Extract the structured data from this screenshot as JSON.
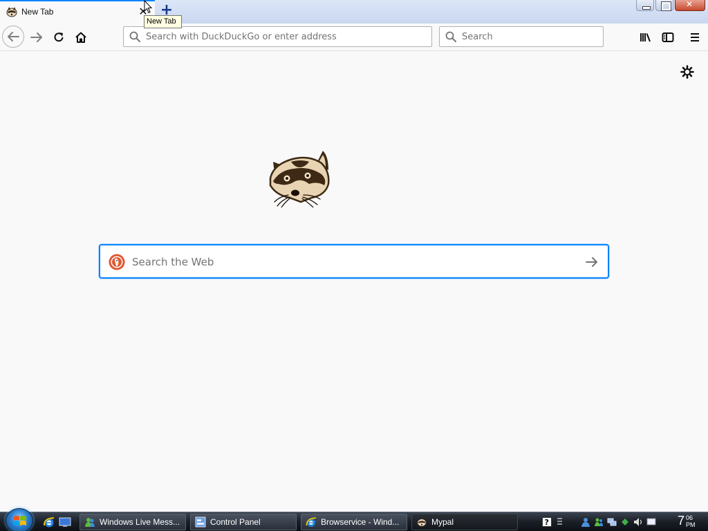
{
  "tab": {
    "title": "New Tab",
    "favicon": "raccoon-favicon",
    "close_icon": "close-icon",
    "new_tab_icon": "plus-icon",
    "tooltip": "New Tab"
  },
  "window_controls": [
    "minimize-icon",
    "maximize-icon",
    "close-icon"
  ],
  "navbar": {
    "back_icon": "back-arrow-icon",
    "forward_icon": "forward-arrow-icon",
    "reload_icon": "reload-icon",
    "home_icon": "home-icon",
    "url_placeholder": "Search with DuckDuckGo or enter address",
    "url_value": "",
    "search_placeholder": "Search",
    "search_value": "",
    "library_icon": "library-icon",
    "sidebar_icon": "sidebar-icon",
    "menu_icon": "hamburger-menu-icon"
  },
  "newtab": {
    "settings_icon": "gear-icon",
    "logo": "raccoon-logo",
    "search_placeholder": "Search the Web",
    "search_value": "",
    "engine_icon": "duckduckgo-icon",
    "go_icon": "arrow-right-icon"
  },
  "taskbar": {
    "start_icon": "windows-start-orb",
    "quick_launch": [
      "internet-explorer-icon",
      "show-desktop-icon"
    ],
    "tasks": [
      {
        "label": "Windows Live Mess...",
        "icon": "messenger-icon",
        "active": false
      },
      {
        "label": "Control Panel",
        "icon": "control-panel-icon",
        "active": false
      },
      {
        "label": "Browservice - Wind...",
        "icon": "internet-explorer-icon",
        "active": false
      },
      {
        "label": "Mypal",
        "icon": "raccoon-favicon",
        "active": true
      }
    ],
    "clock": {
      "hour": "7",
      "minute": "06",
      "ampm": "PM"
    }
  },
  "colors": {
    "accent": "#0a84ff",
    "page_background": "#f9f9fa",
    "taskbar": "#1a1f27"
  }
}
